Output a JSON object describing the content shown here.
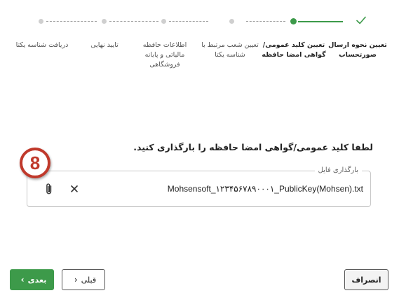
{
  "stepper": {
    "steps": [
      {
        "label": "تعیین نحوه ارسال صورتحساب",
        "state": "completed"
      },
      {
        "label": "تعیین کلید عمومی/ گواهی امضا حافظه",
        "state": "active"
      },
      {
        "label": "تعیین شعب مرتبط با شناسه یکتا",
        "state": "pending"
      },
      {
        "label": "اطلاعات حافظه مالیاتی و پایانه فروشگاهی",
        "state": "pending"
      },
      {
        "label": "تایید نهایی",
        "state": "pending"
      },
      {
        "label": "دریافت شناسه یکتا",
        "state": "pending"
      }
    ],
    "colors": {
      "accent": "#3d9a4a",
      "pending_dot": "#cfcfcf"
    }
  },
  "prompt": "لطفا کلید عمومی/گواهی امضا حافظه را بارگذاری کنید.",
  "file_field": {
    "legend": "بارگذاری فایل",
    "value": "Mohsensoft_۱۲۳۴۵۶۷۸۹۰۰۰۱_PublicKey(Mohsen).txt",
    "icons": {
      "clear": "close-icon",
      "attach": "paperclip-icon"
    }
  },
  "callout": {
    "number": "8",
    "color": "#c0392b"
  },
  "buttons": {
    "next_label": "بعدی",
    "prev_label": "قبلی",
    "cancel_label": "انصراف"
  }
}
